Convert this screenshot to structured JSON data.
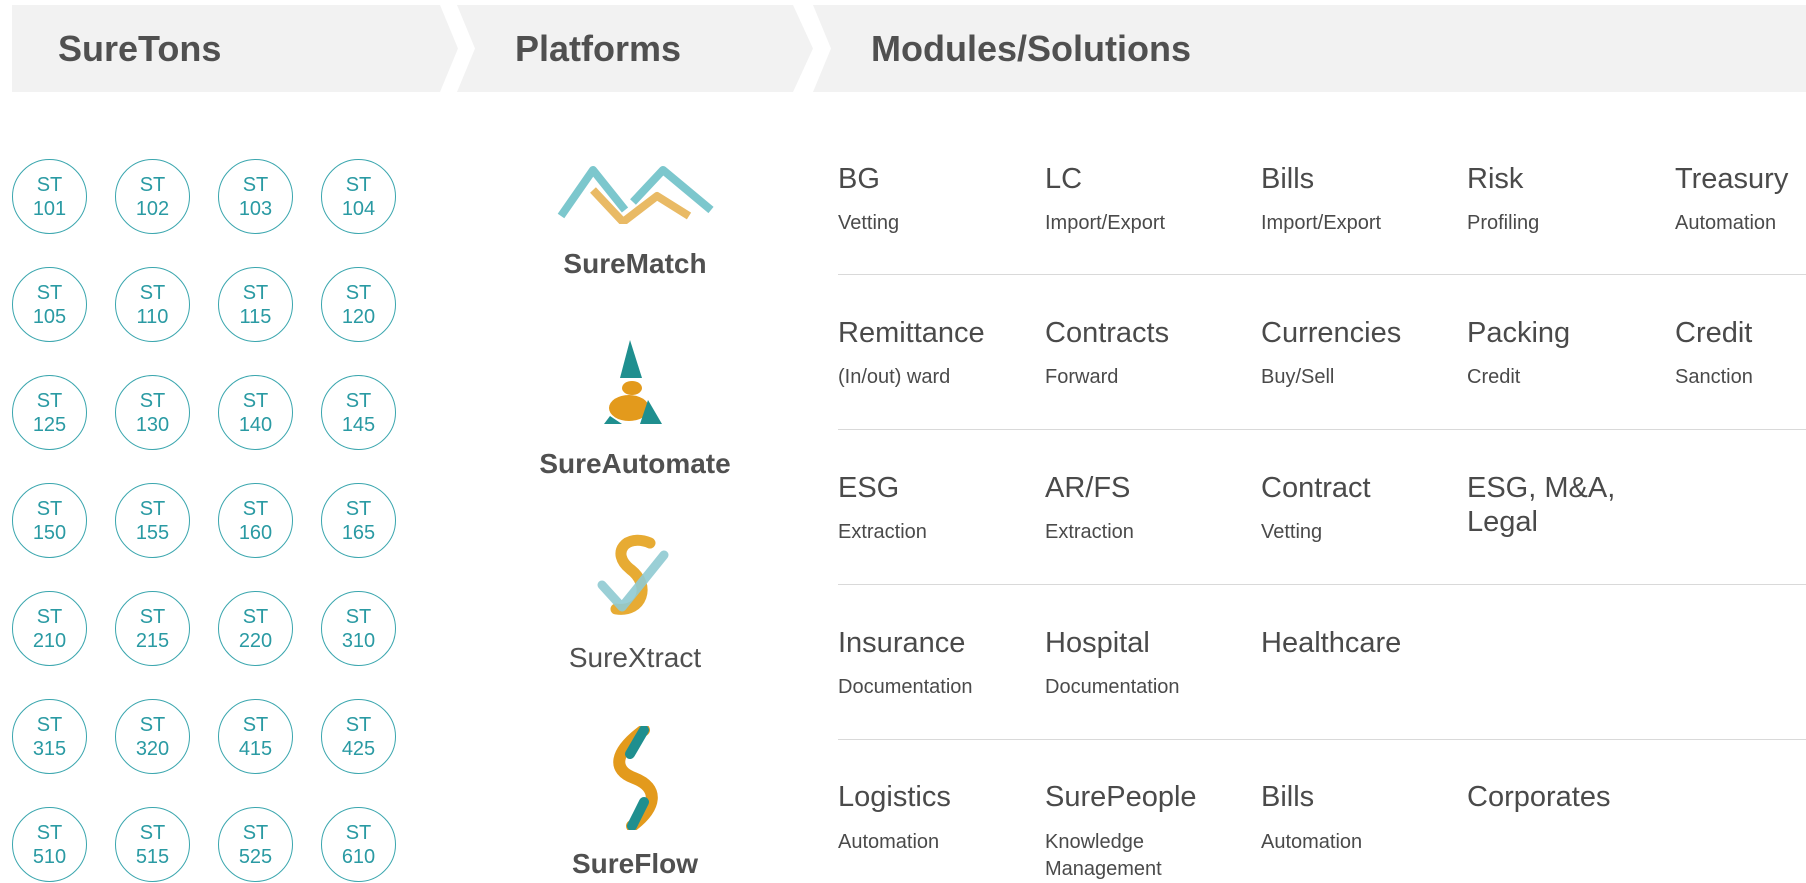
{
  "header": {
    "col1": "SureTons",
    "col2": "Platforms",
    "col3": "Modules/Solutions"
  },
  "suretons": {
    "prefix": "ST",
    "codes": [
      "101",
      "102",
      "103",
      "104",
      "105",
      "110",
      "115",
      "120",
      "125",
      "130",
      "140",
      "145",
      "150",
      "155",
      "160",
      "165",
      "210",
      "215",
      "220",
      "310",
      "315",
      "320",
      "415",
      "425",
      "510",
      "515",
      "525",
      "610"
    ]
  },
  "platforms": [
    {
      "name": "SureMatch",
      "icon": "surematch-logo-icon"
    },
    {
      "name": "SureAutomate",
      "icon": "sureautomate-logo-icon"
    },
    {
      "name": "SureXtract",
      "icon": "surextract-logo-icon"
    },
    {
      "name": "SureFlow",
      "icon": "sureflow-logo-icon"
    }
  ],
  "modules": {
    "r0": [
      {
        "title": "BG",
        "sub": "Vetting"
      },
      {
        "title": "LC",
        "sub": "Import/Export"
      },
      {
        "title": "Bills",
        "sub": "Import/Export"
      },
      {
        "title": "Risk",
        "sub": "Profiling"
      },
      {
        "title": "Treasury",
        "sub": "Automation"
      }
    ],
    "r1": [
      {
        "title": "Remittance",
        "sub": "(In/out) ward"
      },
      {
        "title": "Contracts",
        "sub": "Forward"
      },
      {
        "title": "Currencies",
        "sub": "Buy/Sell"
      },
      {
        "title": "Packing",
        "sub": "Credit"
      },
      {
        "title": "Credit",
        "sub": "Sanction"
      }
    ],
    "r2": [
      {
        "title": "ESG",
        "sub": "Extraction"
      },
      {
        "title": "AR/FS",
        "sub": "Extraction"
      },
      {
        "title": "Contract",
        "sub": "Vetting"
      },
      {
        "title_l1": "ESG, M&A,",
        "title_l2": "Legal"
      }
    ],
    "r3": [
      {
        "title": "Insurance",
        "sub": "Documentation"
      },
      {
        "title": "Hospital",
        "sub": "Documentation"
      },
      {
        "title": "Healthcare"
      }
    ],
    "r4": [
      {
        "title": "Logistics",
        "sub": "Automation"
      },
      {
        "title": "SurePeople",
        "sub_l1": "Knowledge",
        "sub_l2": "Management"
      },
      {
        "title": "Bills",
        "sub": "Automation"
      },
      {
        "title": "Corporates"
      }
    ]
  },
  "colors": {
    "teal": "#3aa6ae",
    "gold": "#e0a23a",
    "header_bg": "#f2f2f2",
    "text": "#4a4a4a"
  }
}
